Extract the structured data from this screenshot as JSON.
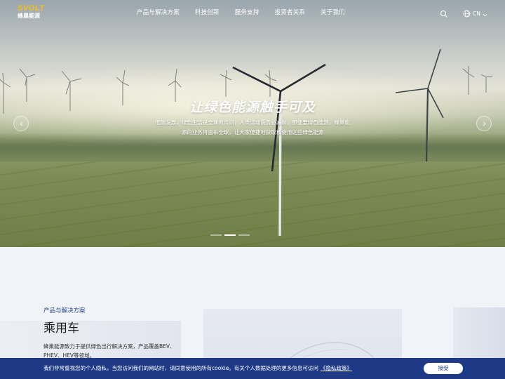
{
  "brand": {
    "logo_text": "SVOLT",
    "logo_cn": "蜂巢能源"
  },
  "nav": {
    "items": [
      {
        "label": "产品与解决方案"
      },
      {
        "label": "科技创新"
      },
      {
        "label": "服务支持"
      },
      {
        "label": "投资者关系"
      },
      {
        "label": "关于我们"
      }
    ],
    "search_icon": "search-icon",
    "language_icon": "globe-icon",
    "language_label": "CN"
  },
  "hero": {
    "slogan": "让绿色能源触手可及",
    "description": "低碳发展，绿色生活是全球的共识，人类活动需务必减碳，那便要绿色能源。蜂巢能源的业务将遍布全球，让大家便捷地获取和使用这些绿色能源",
    "slide_count": 3,
    "active_slide": 1
  },
  "section": {
    "category": "产品与解决方案",
    "title": "乘用车",
    "description": "蜂巢能源致力于提供绿色出行解决方案，产品覆盖BEV、PHEV、HEV等领域。"
  },
  "cookie": {
    "text": "我们非常重视您的个人隐私，当您访问我们的网站时，请同意使用的所有cookie。有关个人数据处理的更多信息可访问",
    "link_label": "《隐私政策》",
    "accept_label": "接受"
  },
  "colors": {
    "brand_blue": "#1e3a86",
    "logo_yellow": "#f2c21b",
    "category_blue": "#2a4a8c"
  }
}
